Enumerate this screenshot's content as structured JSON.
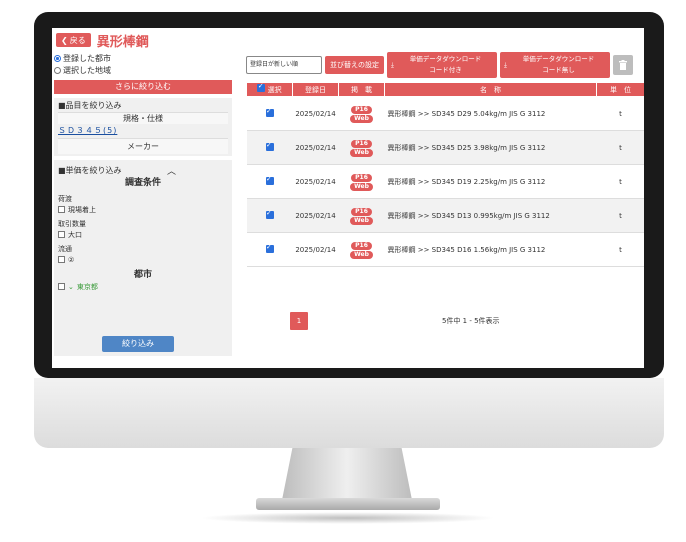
{
  "header": {
    "back_label": "戻る",
    "title": "異形棒鋼"
  },
  "sidebar": {
    "radio_registered": "登録した都市",
    "radio_selected": "選択した地域",
    "filter_head": "さらに絞り込む",
    "product_filter": "■品目を絞り込み",
    "spec_head": "規格・仕様",
    "spec_link": "ＳＤ３４５(5)",
    "maker_label": "メーカー",
    "price_filter": "■単価を絞り込み",
    "cond_title": "調査条件",
    "groups": [
      {
        "label": "荷渡",
        "option": "現場着上"
      },
      {
        "label": "取引数量",
        "option": "大口"
      },
      {
        "label": "流通",
        "option": "②"
      }
    ],
    "city_title": "都市",
    "city_option": "東京都",
    "narrow_button": "絞り込み"
  },
  "toolbar": {
    "sort_value": "登録日が新しい順",
    "sort_button": "並び替えの設定",
    "dl_with_code": "単価データダウンロード\nコード付き",
    "dl_no_code": "単価データダウンロード\nコード無し"
  },
  "table": {
    "headers": [
      "選択",
      "登録日",
      "掲　載",
      "名　称",
      "単　位"
    ],
    "rows": [
      {
        "date": "2025/02/14",
        "badge1": "P16",
        "badge2": "Web",
        "name": "異形棒鋼 >> SD345 D29 5.04kg/m JIS G 3112",
        "unit": "t"
      },
      {
        "date": "2025/02/14",
        "badge1": "P16",
        "badge2": "Web",
        "name": "異形棒鋼 >> SD345 D25 3.98kg/m JIS G 3112",
        "unit": "t"
      },
      {
        "date": "2025/02/14",
        "badge1": "P16",
        "badge2": "Web",
        "name": "異形棒鋼 >> SD345 D19 2.25kg/m JIS G 3112",
        "unit": "t"
      },
      {
        "date": "2025/02/14",
        "badge1": "P16",
        "badge2": "Web",
        "name": "異形棒鋼 >> SD345 D13 0.995kg/m JIS G 3112",
        "unit": "t"
      },
      {
        "date": "2025/02/14",
        "badge1": "P16",
        "badge2": "Web",
        "name": "異形棒鋼 >> SD345 D16 1.56kg/m JIS G 3112",
        "unit": "t"
      }
    ]
  },
  "pager": {
    "page": "1",
    "count_text": "5件中 1 - 5件表示"
  },
  "colors": {
    "accent": "#e05a5a",
    "button_blue": "#4f86c6",
    "checkbox": "#2a6fdb"
  }
}
